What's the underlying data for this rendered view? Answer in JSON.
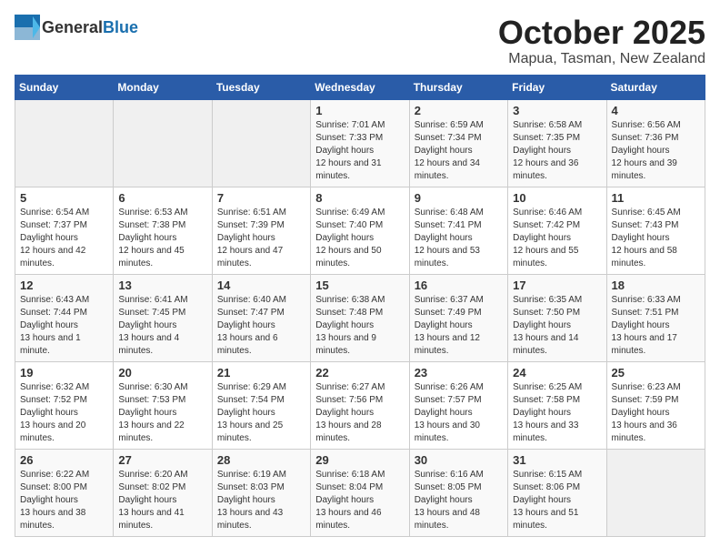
{
  "header": {
    "logo_general": "General",
    "logo_blue": "Blue",
    "month": "October 2025",
    "location": "Mapua, Tasman, New Zealand"
  },
  "days_of_week": [
    "Sunday",
    "Monday",
    "Tuesday",
    "Wednesday",
    "Thursday",
    "Friday",
    "Saturday"
  ],
  "weeks": [
    [
      {
        "day": "",
        "empty": true
      },
      {
        "day": "",
        "empty": true
      },
      {
        "day": "",
        "empty": true
      },
      {
        "day": "1",
        "sunrise": "7:01 AM",
        "sunset": "7:33 PM",
        "daylight": "12 hours and 31 minutes."
      },
      {
        "day": "2",
        "sunrise": "6:59 AM",
        "sunset": "7:34 PM",
        "daylight": "12 hours and 34 minutes."
      },
      {
        "day": "3",
        "sunrise": "6:58 AM",
        "sunset": "7:35 PM",
        "daylight": "12 hours and 36 minutes."
      },
      {
        "day": "4",
        "sunrise": "6:56 AM",
        "sunset": "7:36 PM",
        "daylight": "12 hours and 39 minutes."
      }
    ],
    [
      {
        "day": "5",
        "sunrise": "6:54 AM",
        "sunset": "7:37 PM",
        "daylight": "12 hours and 42 minutes."
      },
      {
        "day": "6",
        "sunrise": "6:53 AM",
        "sunset": "7:38 PM",
        "daylight": "12 hours and 45 minutes."
      },
      {
        "day": "7",
        "sunrise": "6:51 AM",
        "sunset": "7:39 PM",
        "daylight": "12 hours and 47 minutes."
      },
      {
        "day": "8",
        "sunrise": "6:49 AM",
        "sunset": "7:40 PM",
        "daylight": "12 hours and 50 minutes."
      },
      {
        "day": "9",
        "sunrise": "6:48 AM",
        "sunset": "7:41 PM",
        "daylight": "12 hours and 53 minutes."
      },
      {
        "day": "10",
        "sunrise": "6:46 AM",
        "sunset": "7:42 PM",
        "daylight": "12 hours and 55 minutes."
      },
      {
        "day": "11",
        "sunrise": "6:45 AM",
        "sunset": "7:43 PM",
        "daylight": "12 hours and 58 minutes."
      }
    ],
    [
      {
        "day": "12",
        "sunrise": "6:43 AM",
        "sunset": "7:44 PM",
        "daylight": "13 hours and 1 minute."
      },
      {
        "day": "13",
        "sunrise": "6:41 AM",
        "sunset": "7:45 PM",
        "daylight": "13 hours and 4 minutes."
      },
      {
        "day": "14",
        "sunrise": "6:40 AM",
        "sunset": "7:47 PM",
        "daylight": "13 hours and 6 minutes."
      },
      {
        "day": "15",
        "sunrise": "6:38 AM",
        "sunset": "7:48 PM",
        "daylight": "13 hours and 9 minutes."
      },
      {
        "day": "16",
        "sunrise": "6:37 AM",
        "sunset": "7:49 PM",
        "daylight": "13 hours and 12 minutes."
      },
      {
        "day": "17",
        "sunrise": "6:35 AM",
        "sunset": "7:50 PM",
        "daylight": "13 hours and 14 minutes."
      },
      {
        "day": "18",
        "sunrise": "6:33 AM",
        "sunset": "7:51 PM",
        "daylight": "13 hours and 17 minutes."
      }
    ],
    [
      {
        "day": "19",
        "sunrise": "6:32 AM",
        "sunset": "7:52 PM",
        "daylight": "13 hours and 20 minutes."
      },
      {
        "day": "20",
        "sunrise": "6:30 AM",
        "sunset": "7:53 PM",
        "daylight": "13 hours and 22 minutes."
      },
      {
        "day": "21",
        "sunrise": "6:29 AM",
        "sunset": "7:54 PM",
        "daylight": "13 hours and 25 minutes."
      },
      {
        "day": "22",
        "sunrise": "6:27 AM",
        "sunset": "7:56 PM",
        "daylight": "13 hours and 28 minutes."
      },
      {
        "day": "23",
        "sunrise": "6:26 AM",
        "sunset": "7:57 PM",
        "daylight": "13 hours and 30 minutes."
      },
      {
        "day": "24",
        "sunrise": "6:25 AM",
        "sunset": "7:58 PM",
        "daylight": "13 hours and 33 minutes."
      },
      {
        "day": "25",
        "sunrise": "6:23 AM",
        "sunset": "7:59 PM",
        "daylight": "13 hours and 36 minutes."
      }
    ],
    [
      {
        "day": "26",
        "sunrise": "6:22 AM",
        "sunset": "8:00 PM",
        "daylight": "13 hours and 38 minutes."
      },
      {
        "day": "27",
        "sunrise": "6:20 AM",
        "sunset": "8:02 PM",
        "daylight": "13 hours and 41 minutes."
      },
      {
        "day": "28",
        "sunrise": "6:19 AM",
        "sunset": "8:03 PM",
        "daylight": "13 hours and 43 minutes."
      },
      {
        "day": "29",
        "sunrise": "6:18 AM",
        "sunset": "8:04 PM",
        "daylight": "13 hours and 46 minutes."
      },
      {
        "day": "30",
        "sunrise": "6:16 AM",
        "sunset": "8:05 PM",
        "daylight": "13 hours and 48 minutes."
      },
      {
        "day": "31",
        "sunrise": "6:15 AM",
        "sunset": "8:06 PM",
        "daylight": "13 hours and 51 minutes."
      },
      {
        "day": "",
        "empty": true
      }
    ]
  ],
  "labels": {
    "sunrise": "Sunrise:",
    "sunset": "Sunset:",
    "daylight": "Daylight hours"
  }
}
